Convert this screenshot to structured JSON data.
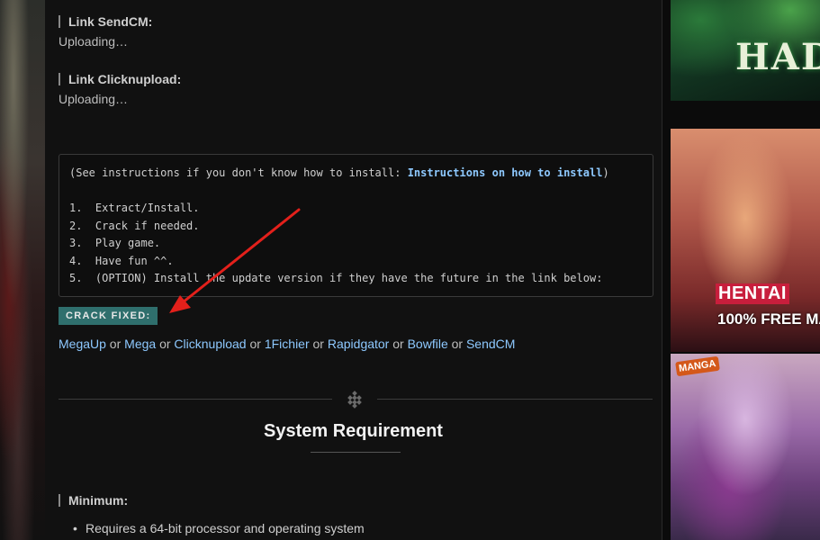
{
  "labels": {
    "sendcm": "Link SendCM:",
    "clicknupload": "Link Clicknupload:",
    "minimum": "Minimum:"
  },
  "statuses": {
    "sendcm": "Uploading…",
    "clicknupload": "Uploading…"
  },
  "instructions": {
    "prefix": "(See instructions if you don't know how to install: ",
    "link": "Instructions on how to install",
    "suffix": ")",
    "steps": [
      "1.  Extract/Install.",
      "2.  Crack if needed.",
      "3.  Play game.",
      "4.  Have fun ^^.",
      "5.  (OPTION) Install the update version if they have the future in the link below:"
    ]
  },
  "crack_badge": "CRACK FIXED:",
  "crack_links": [
    "MegaUp",
    "Mega",
    "Clicknupload",
    "1Fichier",
    "Rapidgator",
    "Bowfile",
    "SendCM"
  ],
  "link_separator": " or ",
  "section_title": "System Requirement",
  "requirements": [
    "Requires a 64-bit processor and operating system"
  ],
  "ads": {
    "hades_text": "HAD",
    "hentai_logo": "HENTAI",
    "hentai_sub": "100% FREE MA",
    "manga_logo": "MANGA"
  },
  "colors": {
    "link": "#8ec9ff",
    "badge": "#2f6f6d",
    "arrow": "#e3201b"
  }
}
